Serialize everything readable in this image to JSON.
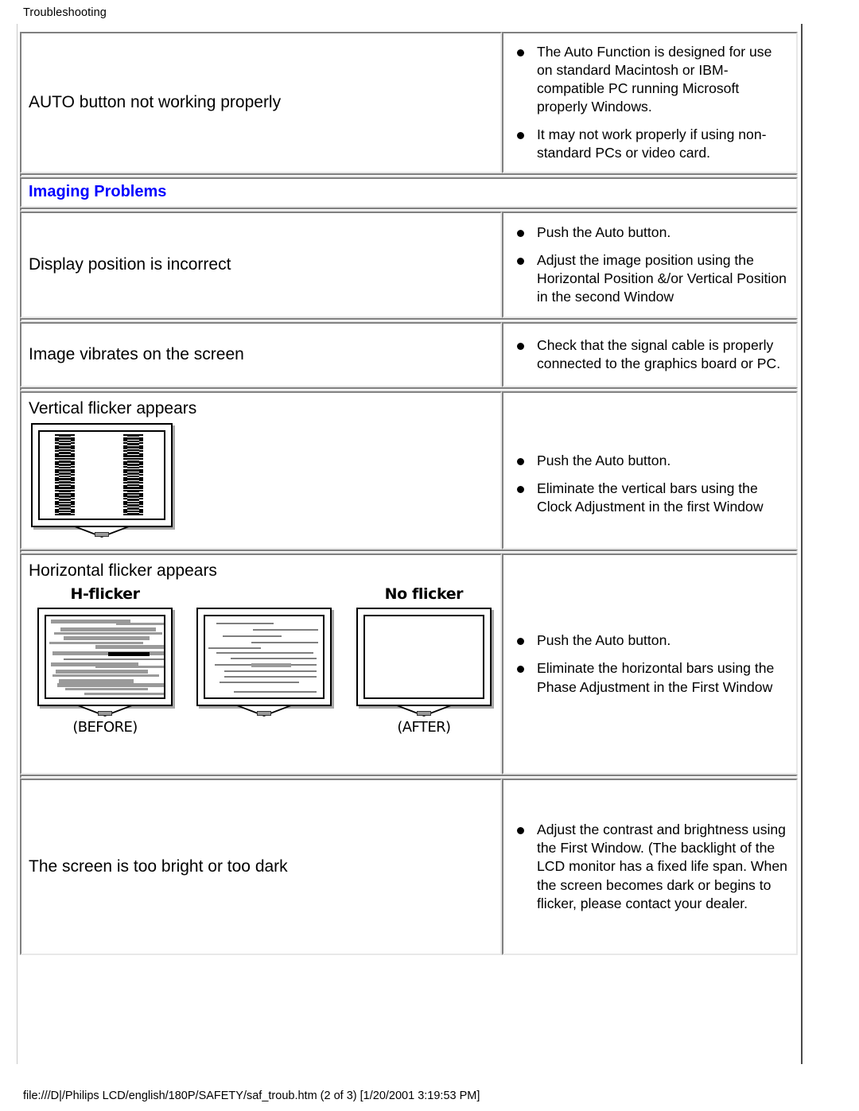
{
  "document": {
    "breadcrumb": "Troubleshooting",
    "footer": "file:///D|/Philips LCD/english/180P/SAFETY/saf_troub.htm (2 of 3) [1/20/2001 3:19:53 PM]",
    "accent_color": "#0000ff",
    "text_color": "#000000",
    "background_color": "#ffffff"
  },
  "rows": [
    {
      "id": "auto-button",
      "problem": "AUTO button not working properly",
      "solutions": [
        "The Auto Function is designed for use on standard Macintosh or IBM-compatible PC running Microsoft properly Windows.",
        "It may not work properly if using non-standard PCs or video card."
      ]
    },
    {
      "id": "display-position",
      "problem": "Display position is incorrect",
      "solutions": [
        "Push the Auto button.",
        "Adjust the image position using the Horizontal Position &/or Vertical Position in the second Window"
      ]
    },
    {
      "id": "image-vibrates",
      "problem": "Image vibrates on the screen",
      "solutions": [
        "Check that the signal cable is properly connected to the graphics board or PC."
      ]
    },
    {
      "id": "vertical-flicker",
      "problem": "Vertical flicker appears",
      "solutions": [
        "Push the Auto button.",
        "Eliminate the vertical bars using the Clock Adjustment in the first Window"
      ]
    },
    {
      "id": "horizontal-flicker",
      "problem": "Horizontal flicker appears",
      "solutions": [
        "Push the Auto button.",
        "Eliminate the horizontal bars using the Phase Adjustment in the First Window"
      ]
    },
    {
      "id": "bright-dark",
      "problem": "The screen is too bright or too dark",
      "solutions": [
        "Adjust the contrast and brightness using the First Window. (The backlight of the LCD monitor has a fixed life span. When the screen becomes dark or begins to flicker, please contact your dealer."
      ]
    }
  ],
  "section_heading": {
    "label": "Imaging Problems"
  },
  "figures": {
    "vertical_flicker": {
      "name": "vertical-flicker-monitor-illustration"
    },
    "horizontal_flicker": {
      "monitors": [
        {
          "label": "H-flicker",
          "caption": "(BEFORE)",
          "state": "flicker"
        },
        {
          "label": "",
          "caption": "",
          "state": "partial"
        },
        {
          "label": "No flicker",
          "caption": "(AFTER)",
          "state": "clean"
        }
      ]
    }
  }
}
